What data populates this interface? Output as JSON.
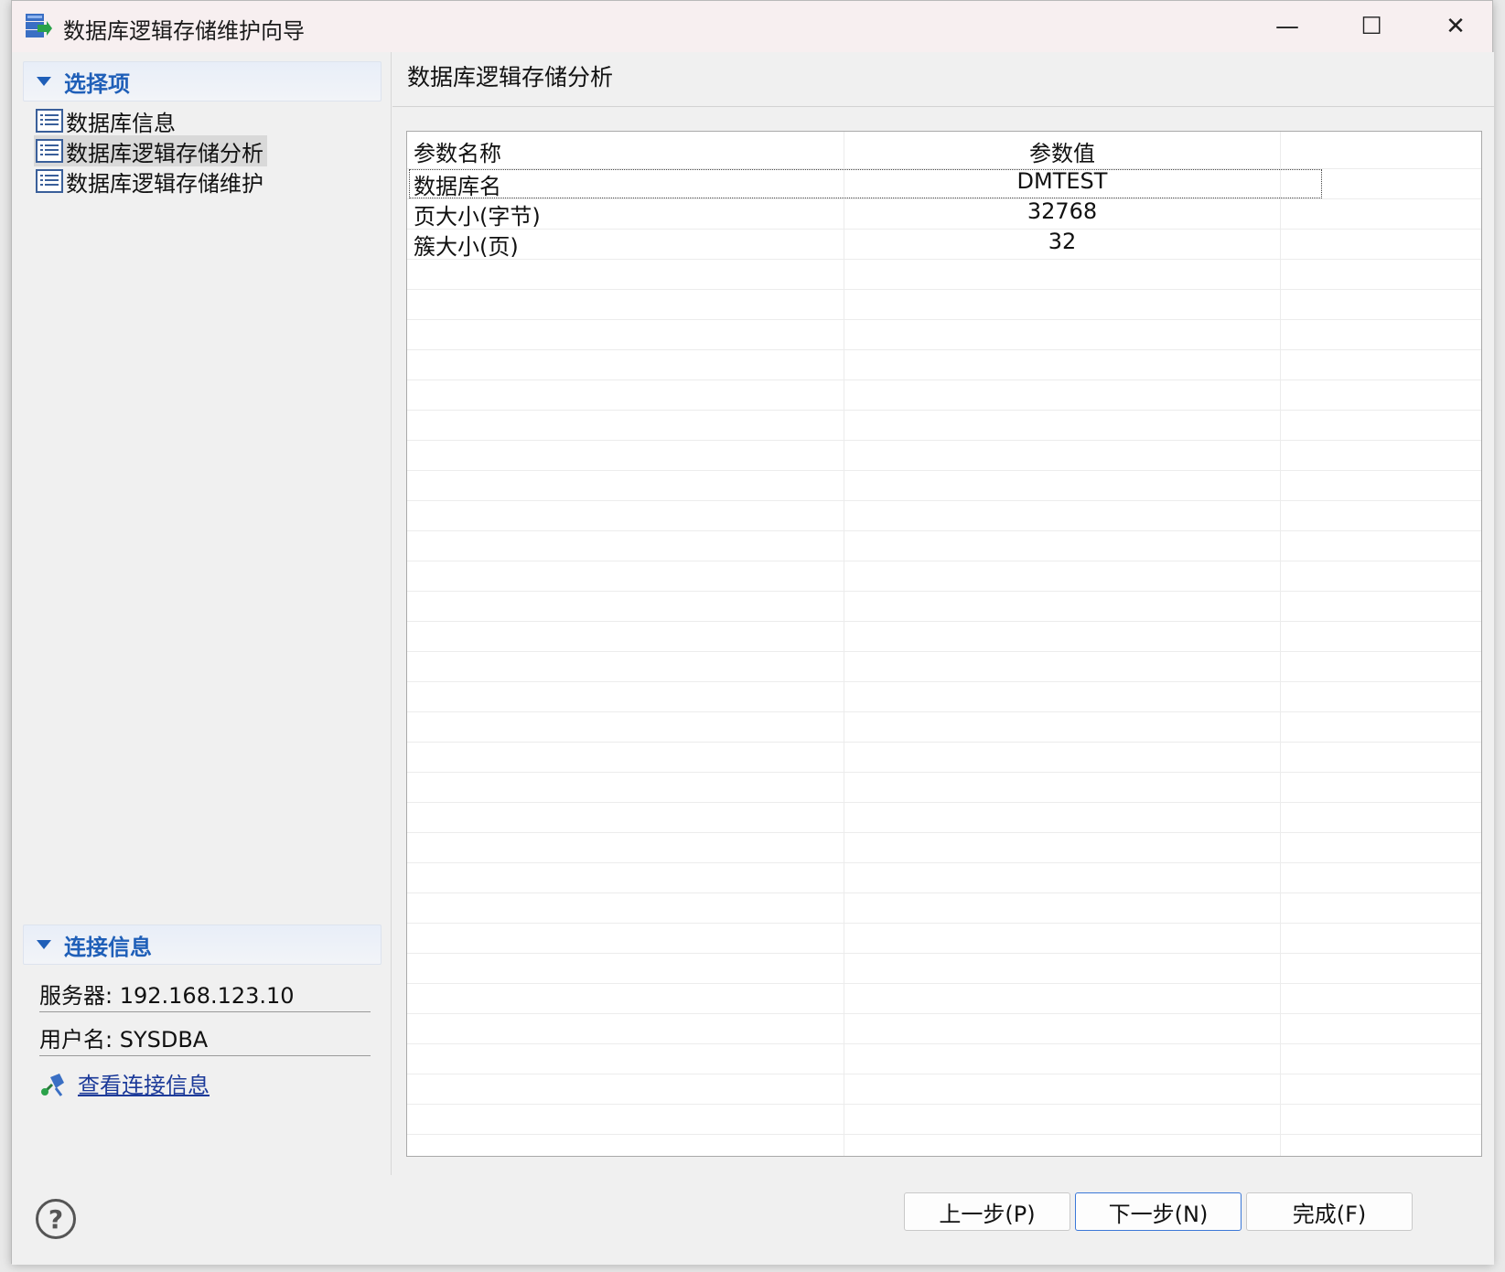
{
  "window": {
    "title": "数据库逻辑存储维护向导",
    "icon": "database-wizard-icon",
    "controls": {
      "minimize": "—",
      "maximize": "☐",
      "close": "✕"
    }
  },
  "sidebar": {
    "section_title": "选择项",
    "items": [
      {
        "label": "数据库信息",
        "selected": false
      },
      {
        "label": "数据库逻辑存储分析",
        "selected": true
      },
      {
        "label": "数据库逻辑存储维护",
        "selected": false
      }
    ]
  },
  "connection": {
    "section_title": "连接信息",
    "server": "服务器: 192.168.123.10",
    "user": "用户名: SYSDBA",
    "link": "查看连接信息"
  },
  "main": {
    "title": "数据库逻辑存储分析",
    "table": {
      "columns": [
        "参数名称",
        "参数值"
      ],
      "rows": [
        [
          "数据库名",
          "DMTEST"
        ],
        [
          "页大小(字节)",
          "32768"
        ],
        [
          "簇大小(页)",
          "32"
        ]
      ]
    }
  },
  "footer": {
    "help": "?",
    "back": "上一步(P)",
    "next": "下一步(N)",
    "finish": "完成(F)"
  },
  "colors": {
    "accent": "#1f5fb8",
    "link": "#1c3a99",
    "primary_border": "#3b78d8"
  }
}
